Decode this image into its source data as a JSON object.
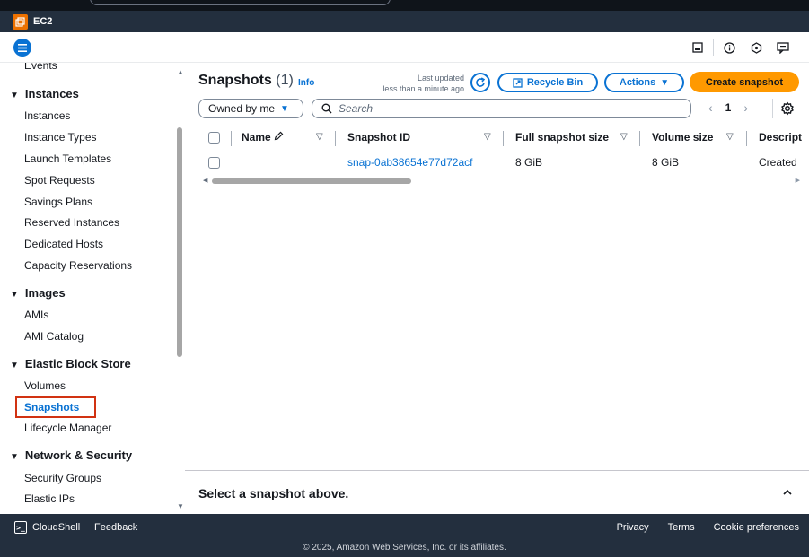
{
  "service": {
    "label": "EC2"
  },
  "sidebar": {
    "items": [
      {
        "label": "Events"
      },
      {
        "group": "Instances"
      },
      {
        "label": "Instances"
      },
      {
        "label": "Instance Types"
      },
      {
        "label": "Launch Templates"
      },
      {
        "label": "Spot Requests"
      },
      {
        "label": "Savings Plans"
      },
      {
        "label": "Reserved Instances"
      },
      {
        "label": "Dedicated Hosts"
      },
      {
        "label": "Capacity Reservations"
      },
      {
        "group": "Images"
      },
      {
        "label": "AMIs"
      },
      {
        "label": "AMI Catalog"
      },
      {
        "group": "Elastic Block Store"
      },
      {
        "label": "Volumes"
      },
      {
        "label": "Snapshots",
        "active": true
      },
      {
        "label": "Lifecycle Manager"
      },
      {
        "group": "Network & Security"
      },
      {
        "label": "Security Groups"
      },
      {
        "label": "Elastic IPs"
      }
    ]
  },
  "main": {
    "title": "Snapshots",
    "count": "(1)",
    "info": "Info",
    "last_updated_line1": "Last updated",
    "last_updated_line2": "less than a minute ago",
    "recycle_bin": "Recycle Bin",
    "actions": "Actions",
    "create": "Create snapshot",
    "filter_value": "Owned by me",
    "search_placeholder": "Search",
    "page": "1"
  },
  "table": {
    "columns": [
      "Name",
      "Snapshot ID",
      "Full snapshot size",
      "Volume size",
      "Descript"
    ],
    "rows": [
      {
        "name": "",
        "snapshot_id": "snap-0ab38654e77d72acf",
        "full_size": "8 GiB",
        "volume_size": "8 GiB",
        "description": "Created"
      }
    ]
  },
  "split_panel": {
    "title": "Select a snapshot above."
  },
  "footer": {
    "cloudshell": "CloudShell",
    "feedback": "Feedback",
    "privacy": "Privacy",
    "terms": "Terms",
    "cookies": "Cookie preferences",
    "copyright": "© 2025, Amazon Web Services, Inc. or its affiliates."
  },
  "colors": {
    "accent": "#0972d3",
    "primary_button": "#ff9900",
    "nav_bg": "#232f3e",
    "highlight_border": "#d13212"
  }
}
